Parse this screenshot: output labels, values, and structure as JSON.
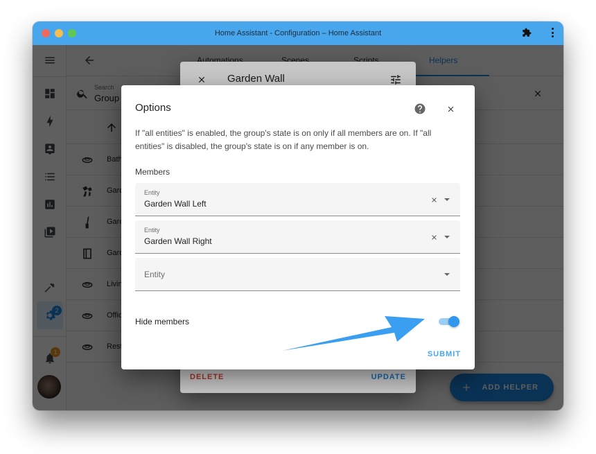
{
  "window": {
    "title": "Home Assistant - Configuration – Home Assistant",
    "titlebar_color": "#47a6ec"
  },
  "sidebar": {
    "items": [
      {
        "icon": "menu-icon"
      },
      {
        "icon": "dashboard-icon"
      },
      {
        "icon": "energy-icon"
      },
      {
        "icon": "map-account-icon"
      },
      {
        "icon": "logbook-icon"
      },
      {
        "icon": "history-icon"
      },
      {
        "icon": "media-icon"
      },
      {
        "icon": "hammer-icon"
      },
      {
        "icon": "settings-cog-icon",
        "badge": "2",
        "active": true
      }
    ],
    "notifications_badge": "1",
    "settings_badge": "2"
  },
  "topbar": {
    "tabs": [
      {
        "label": "Automations"
      },
      {
        "label": "Scenes"
      },
      {
        "label": "Scripts"
      },
      {
        "label": "Helpers",
        "active": true
      }
    ]
  },
  "search": {
    "label": "Search",
    "value": "Group"
  },
  "list": {
    "rows": [
      {
        "icon": "ceiling-light-icon",
        "text": "Bath"
      },
      {
        "icon": "spotlight-icon",
        "text": "Gard"
      },
      {
        "icon": "post-lamp-icon",
        "text": "Gard"
      },
      {
        "icon": "wall-lamp-icon",
        "text": "Gard"
      },
      {
        "icon": "ceiling-light-icon",
        "text": "Livin"
      },
      {
        "icon": "ceiling-light-icon",
        "text": "Offic"
      },
      {
        "icon": "ceiling-light-icon",
        "text": "Rest"
      }
    ]
  },
  "fab": {
    "label": "ADD HELPER"
  },
  "entity_dialog": {
    "title": "Garden Wall",
    "delete_label": "DELETE",
    "update_label": "UPDATE"
  },
  "options_dialog": {
    "title": "Options",
    "description": "If \"all entities\" is enabled, the group's state is on only if all members are on. If \"all entities\" is disabled, the group's state is on if any member is on.",
    "members_label": "Members",
    "fields": [
      {
        "label": "Entity",
        "value": "Garden Wall Left"
      },
      {
        "label": "Entity",
        "value": "Garden Wall Right"
      },
      {
        "label": "Entity",
        "value": ""
      }
    ],
    "empty_placeholder": "Entity",
    "hide_members_label": "Hide members",
    "hide_members_enabled": true,
    "submit_label": "SUBMIT"
  },
  "annotation": {
    "type": "arrow",
    "color": "#3a9ff0",
    "points_to": "hide-members-toggle"
  }
}
